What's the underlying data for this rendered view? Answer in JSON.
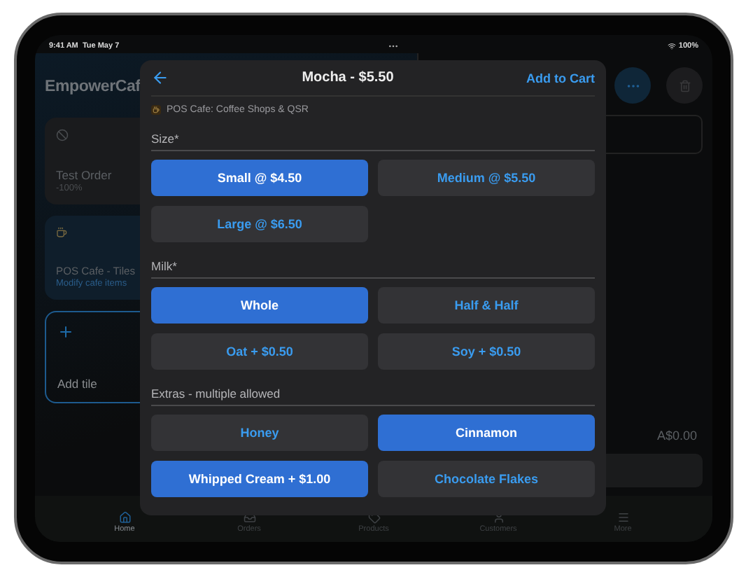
{
  "status_bar": {
    "time": "9:41 AM",
    "date": "Tue May 7",
    "battery": "100%"
  },
  "background": {
    "title": "EmpowerCaf",
    "tiles": [
      {
        "kind": "order",
        "title": "Test Order",
        "subtitle": "-100%"
      },
      {
        "kind": "menu",
        "title": "POS Cafe - Tiles",
        "subtitle": "Modify cafe items"
      },
      {
        "kind": "add",
        "title": "Add tile"
      }
    ],
    "total": "A$0.00"
  },
  "modal": {
    "title": "Mocha - $5.50",
    "action": "Add to Cart",
    "source": "POS Cafe: Coffee Shops & QSR",
    "groups": [
      {
        "label": "Size*",
        "options": [
          {
            "label": "Small @ $4.50",
            "selected": true
          },
          {
            "label": "Medium @ $5.50",
            "selected": false
          },
          {
            "label": "Large @ $6.50",
            "selected": false
          }
        ]
      },
      {
        "label": "Milk*",
        "options": [
          {
            "label": "Whole",
            "selected": true
          },
          {
            "label": "Half & Half",
            "selected": false
          },
          {
            "label": "Oat + $0.50",
            "selected": false
          },
          {
            "label": "Soy + $0.50",
            "selected": false
          }
        ]
      },
      {
        "label": "Extras - multiple allowed",
        "options": [
          {
            "label": "Honey",
            "selected": false
          },
          {
            "label": "Cinnamon",
            "selected": true
          },
          {
            "label": "Whipped Cream + $1.00",
            "selected": true
          },
          {
            "label": "Chocolate Flakes",
            "selected": false
          }
        ]
      }
    ]
  },
  "tab_bar": [
    {
      "label": "Home",
      "selected": true
    },
    {
      "label": "Orders",
      "selected": false
    },
    {
      "label": "Products",
      "selected": false
    },
    {
      "label": "Customers",
      "selected": false
    },
    {
      "label": "More",
      "selected": false
    }
  ]
}
